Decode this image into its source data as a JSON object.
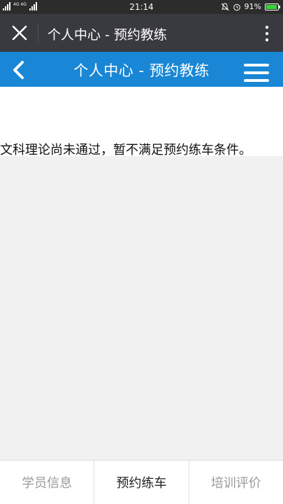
{
  "status_bar": {
    "network_label": "4G 4G",
    "time": "21:14",
    "battery_percent": "91%",
    "battery_level": 0.91
  },
  "webview": {
    "title": "个人中心 - 预约教练"
  },
  "header": {
    "title": "个人中心 - 预约教练"
  },
  "main": {
    "notice": "文科理论尚未通过，暂不满足预约练车条件。"
  },
  "tabs": [
    {
      "label": "学员信息",
      "active": false
    },
    {
      "label": "预约练车",
      "active": true
    },
    {
      "label": "培训评价",
      "active": false
    }
  ],
  "colors": {
    "header_blue": "#1a87d6",
    "webbar_bg": "#393a3f",
    "battery_green": "#3bd13b"
  }
}
